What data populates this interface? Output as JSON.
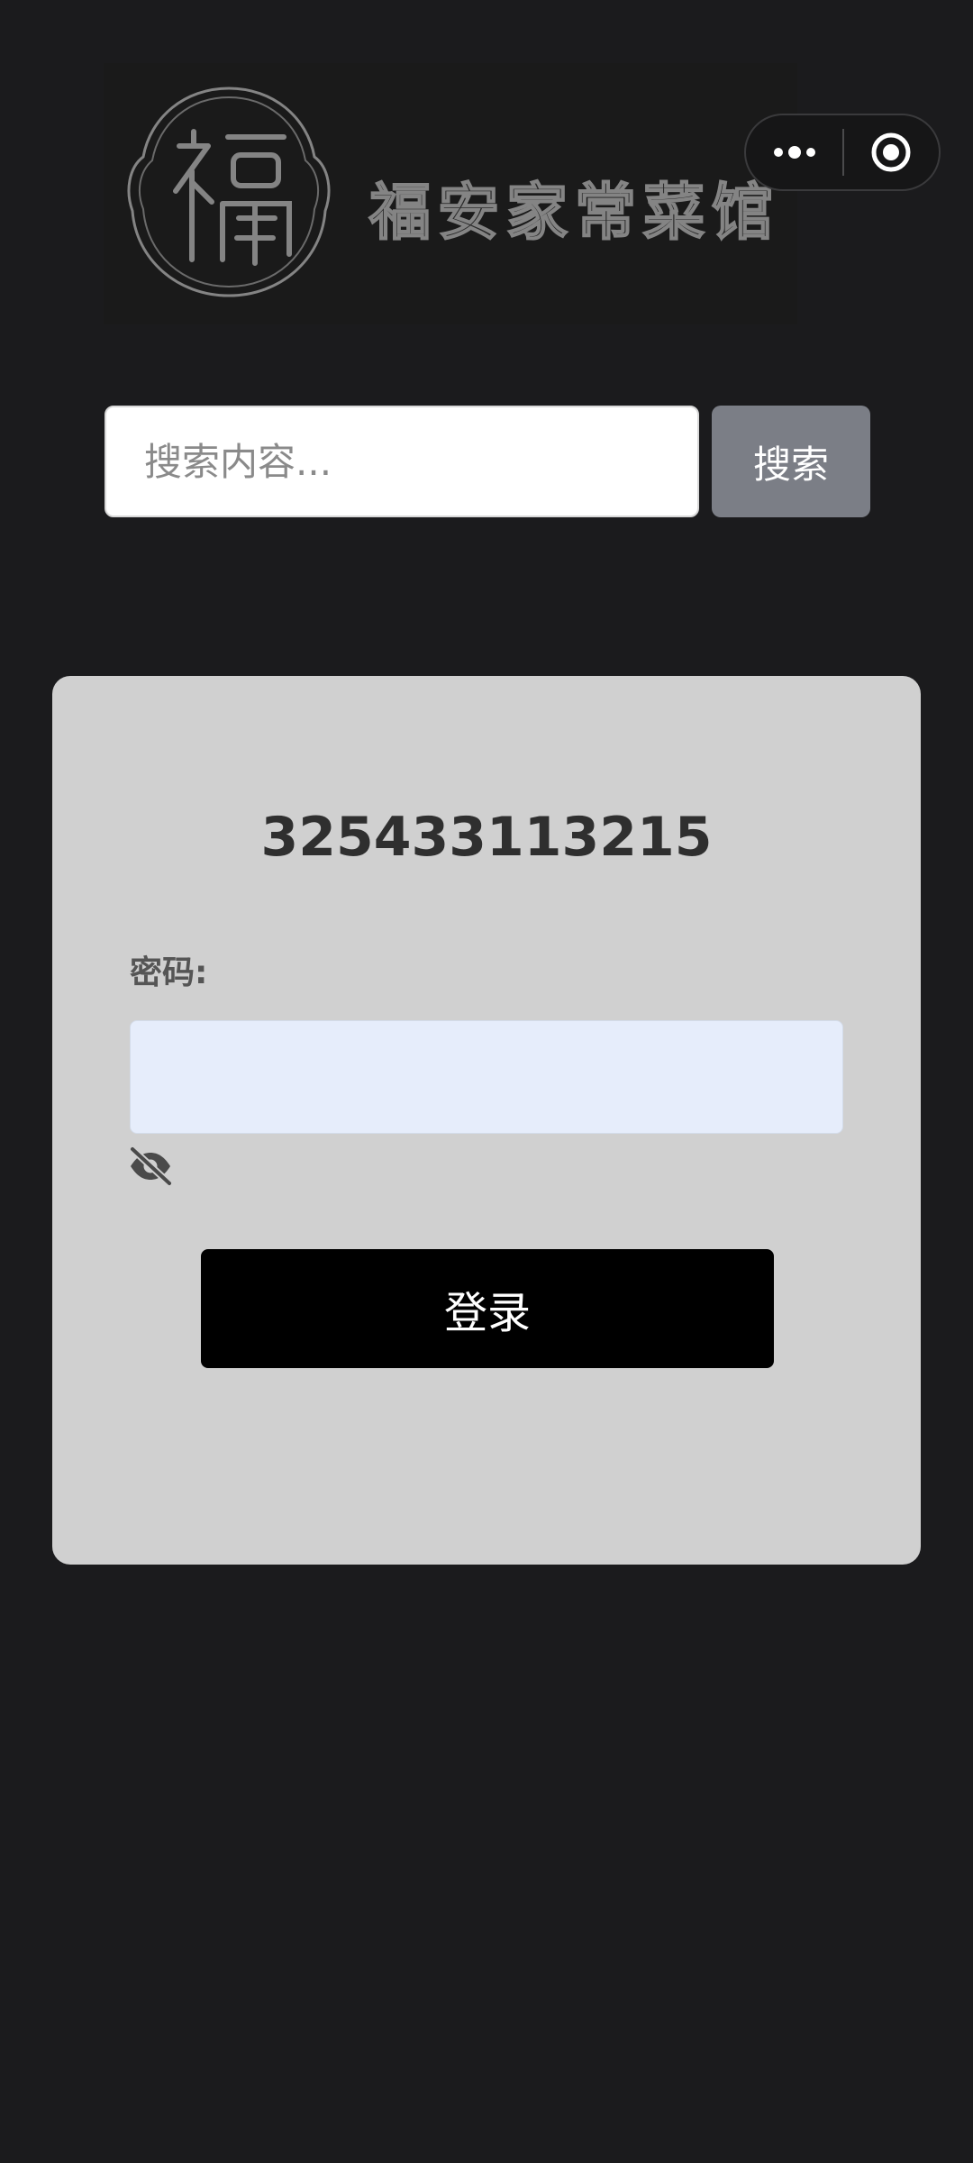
{
  "logo": {
    "name": "福安家常菜馆",
    "emblem_char": "福"
  },
  "capsule": {
    "more_icon": "more-dots-icon",
    "close_icon": "target-circle-icon"
  },
  "search": {
    "placeholder": "搜索内容...",
    "value": "",
    "button_label": "搜索"
  },
  "login": {
    "account": "325433113215",
    "password_label": "密码:",
    "password_value": "",
    "visibility_icon": "eye-slash-icon",
    "submit_label": "登录"
  },
  "colors": {
    "background": "#1b1b1d",
    "card": "#d0d0d0",
    "search_button": "#7b7e86",
    "login_button": "#000000",
    "password_field": "#e6edfb"
  }
}
